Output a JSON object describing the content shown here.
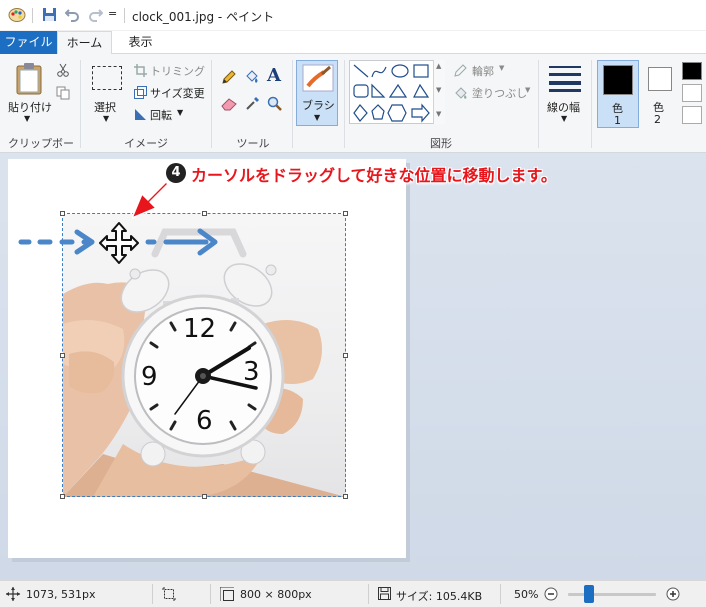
{
  "titlebar": {
    "title": "clock_001.jpg - ペイント",
    "qat_dropdown": "="
  },
  "menu": {
    "file": "ファイル",
    "home": "ホーム",
    "view": "表示"
  },
  "ribbon": {
    "clipboard": {
      "paste": "貼り付け",
      "group_label": "クリップボード"
    },
    "image": {
      "select": "選択",
      "trim": "トリミング",
      "resize": "サイズ変更",
      "rotate": "回転",
      "group_label": "イメージ"
    },
    "tools": {
      "group_label": "ツール"
    },
    "brush": {
      "label": "ブラシ"
    },
    "shapes": {
      "outline": "輪郭",
      "fill": "塗りつぶし",
      "group_label": "図形"
    },
    "line_width": {
      "label": "線の幅"
    },
    "color1": {
      "label": "色",
      "number": "1"
    },
    "color2": {
      "label": "色",
      "number": "2"
    }
  },
  "annotation": {
    "step": "4",
    "text": "カーソルをドラッグして好きな位置に移動します。"
  },
  "clock": {
    "n12": "12",
    "n3": "3",
    "n6": "6",
    "n9": "9"
  },
  "statusbar": {
    "cursor_pos": "1073, 531px",
    "canvas_size": "800 × 800px",
    "file_size": "サイズ: 105.4KB",
    "zoom": "50%",
    "zoom_level": 0.5
  },
  "colors": {
    "accent_blue": "#1c6ec2",
    "annotation_red": "#e8161c",
    "arrow_blue": "#4a86c8",
    "color1": "#000000",
    "color2": "#ffffff"
  }
}
